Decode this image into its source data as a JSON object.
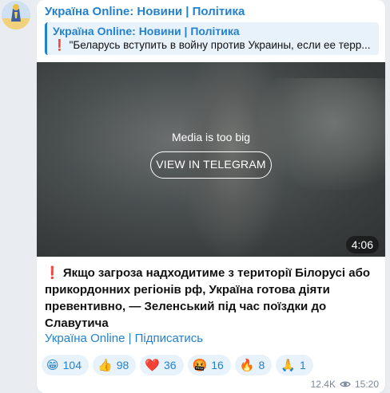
{
  "channel": {
    "author": "Україна Online: Новини | Політика",
    "avatar_icon": "channel-avatar-icon"
  },
  "reply": {
    "title": "Україна Online: Новини | Політика",
    "mark": "❗",
    "text": "\"Беларусь вступить в войну против Украины, если ее терр..."
  },
  "media": {
    "note": "Media is too big",
    "button_label": "VIEW IN TELEGRAM",
    "duration": "4:06"
  },
  "message": {
    "mark": "❗",
    "text": "Якщо загроза надходитиме з території Білорусі або прикордонних регіонів рф, Україна готова діяти превентивно, — Зеленський під час поїздки до Славутича"
  },
  "subscribe_link": "Україна Online | Підписатись",
  "reactions": [
    {
      "emoji": "😁",
      "count": "104"
    },
    {
      "emoji": "👍",
      "count": "98"
    },
    {
      "emoji": "❤️",
      "count": "36"
    },
    {
      "emoji": "🤬",
      "count": "16"
    },
    {
      "emoji": "🔥",
      "count": "8"
    },
    {
      "emoji": "🙏",
      "count": "1"
    }
  ],
  "meta": {
    "views": "12.4K",
    "time": "15:20",
    "views_icon": "eye-icon"
  },
  "colors": {
    "accent": "#2481cc",
    "reaction_bg": "#e8f2fb",
    "alert": "#e0282a"
  }
}
